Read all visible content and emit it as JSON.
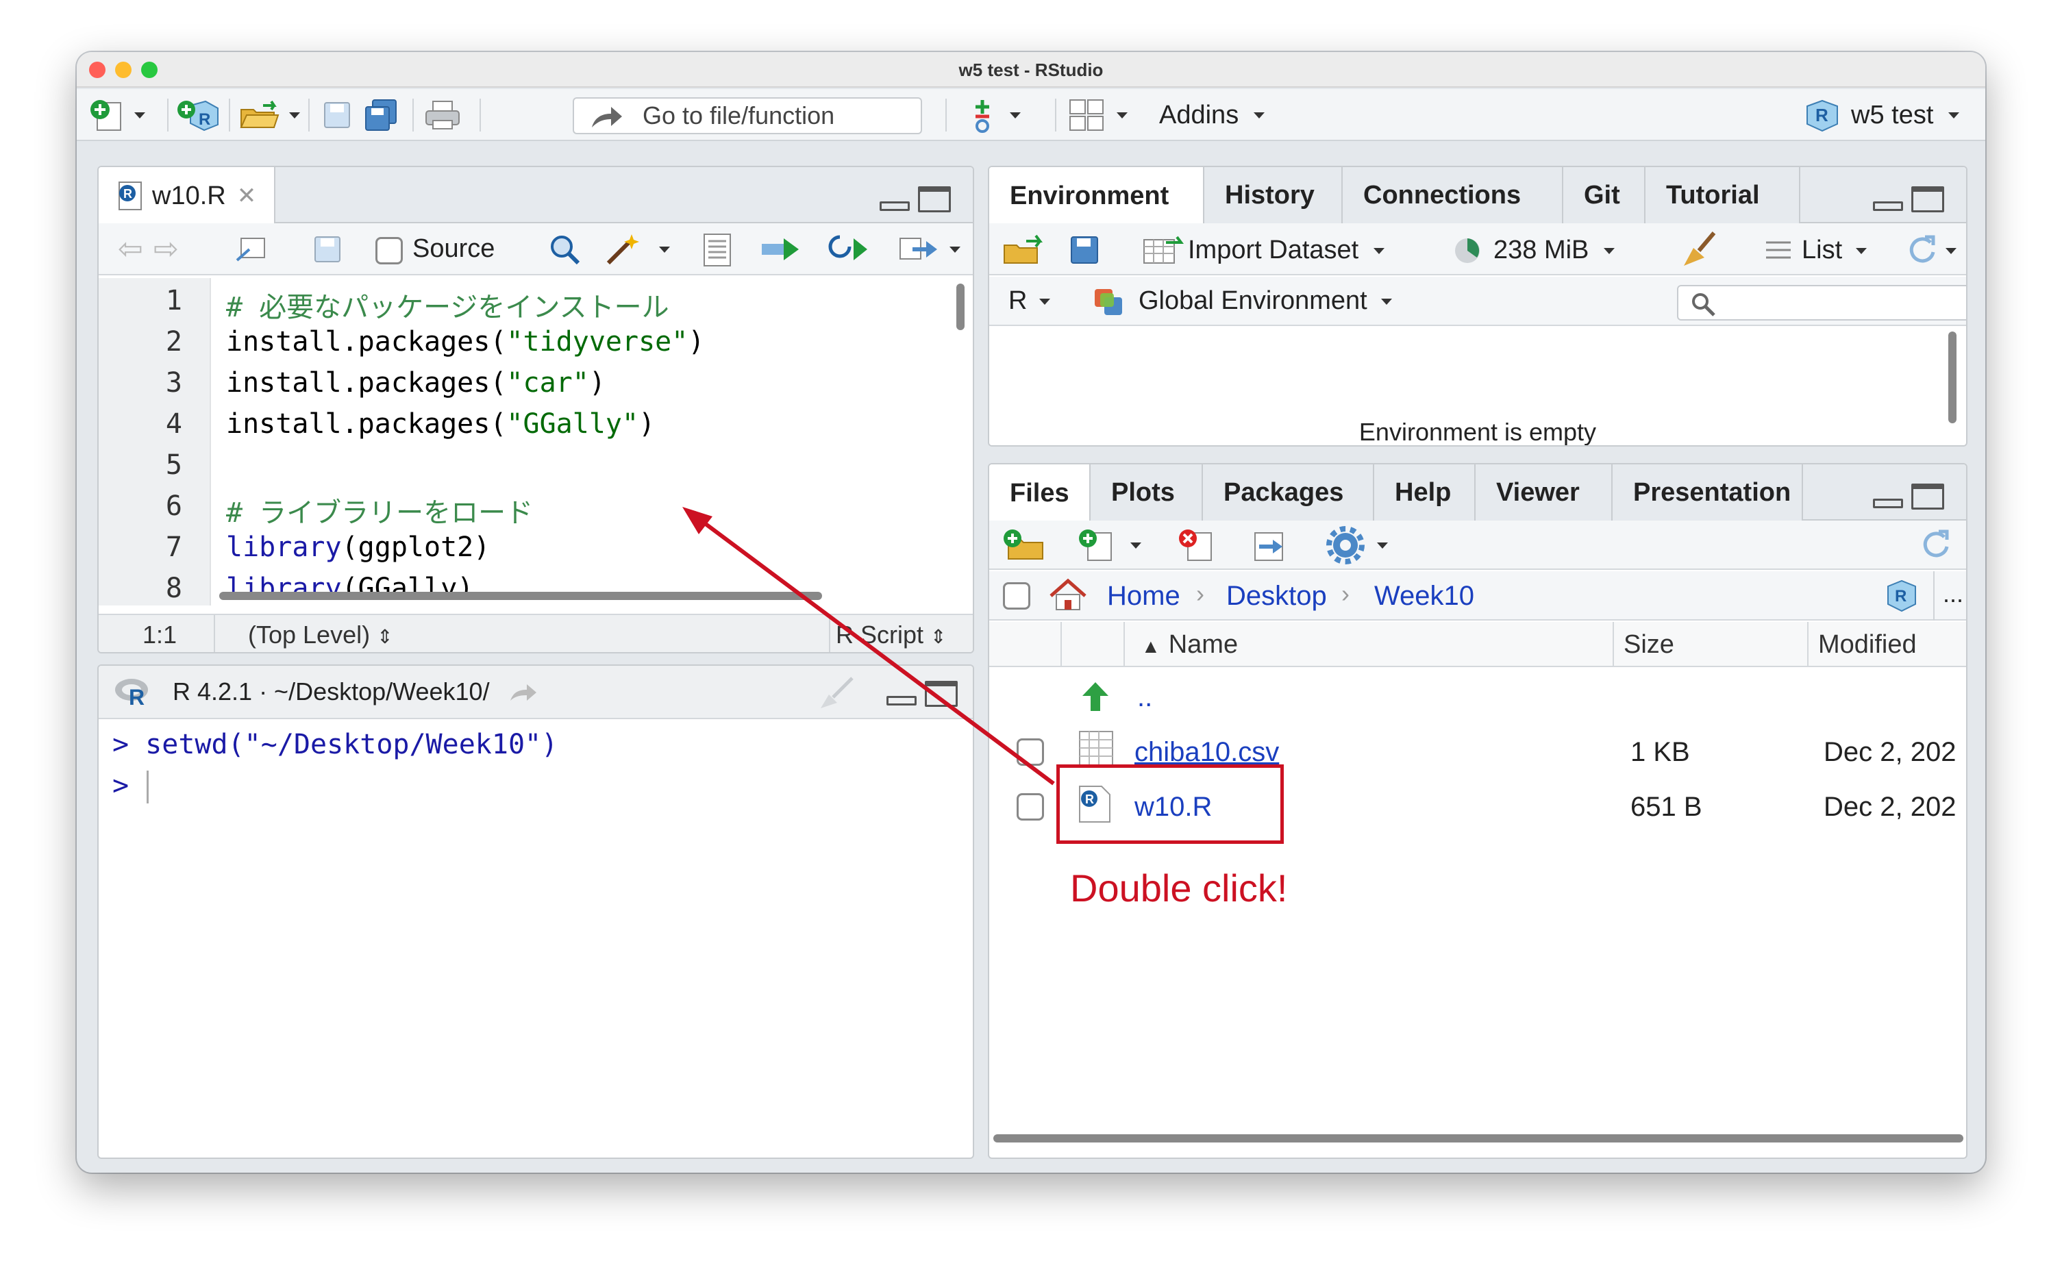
{
  "window": {
    "title": "w5 test - RStudio"
  },
  "toolbar": {
    "goto_placeholder": "Go to file/function",
    "addins_label": "Addins",
    "project_label": "w5 test"
  },
  "source_pane": {
    "tab_label": "w10.R",
    "source_label": "Source",
    "lines": [
      {
        "no": "1",
        "text": "# 必要なパッケージをインストール"
      },
      {
        "no": "2",
        "fn": "install.packages(",
        "str": "\"tidyverse\"",
        "end": ")"
      },
      {
        "no": "3",
        "fn": "install.packages(",
        "str": "\"car\"",
        "end": ")"
      },
      {
        "no": "4",
        "fn": "install.packages(",
        "str": "\"GGally\"",
        "end": ")"
      },
      {
        "no": "5",
        "text": ""
      },
      {
        "no": "6",
        "text": "# ライブラリーをロード"
      },
      {
        "no": "7",
        "kw": "library",
        "rest": "(ggplot2)"
      },
      {
        "no": "8",
        "kw": "library",
        "rest": "(GGally)"
      }
    ],
    "status_position": "1:1",
    "status_scope": "(Top Level)",
    "status_type": "R Script"
  },
  "console_pane": {
    "header": "R 4.2.1 · ~/Desktop/Week10/",
    "line1": "> setwd(\"~/Desktop/Week10\")",
    "prompt": ">"
  },
  "env_pane": {
    "tabs": [
      "Environment",
      "History",
      "Connections",
      "Git",
      "Tutorial"
    ],
    "import_label": "Import Dataset",
    "memory_label": "238 MiB",
    "view_label": "List",
    "lang_label": "R",
    "scope_label": "Global Environment",
    "empty_text": "Environment is empty"
  },
  "files_pane": {
    "tabs": [
      "Files",
      "Plots",
      "Packages",
      "Help",
      "Viewer",
      "Presentation"
    ],
    "breadcrumb": [
      "Home",
      "Desktop",
      "Week10"
    ],
    "more_label": "...",
    "columns": {
      "name": "Name",
      "size": "Size",
      "modified": "Modified"
    },
    "parent_label": "..",
    "rows": [
      {
        "name": "chiba10.csv",
        "size": "1 KB",
        "modified": "Dec 2, 202"
      },
      {
        "name": "w10.R",
        "size": "651 B",
        "modified": "Dec 2, 202"
      }
    ]
  },
  "annotation": {
    "callout": "Double click!",
    "color": "#cc1122"
  },
  "colors": {
    "accent_blue": "#1a3fbf",
    "comment_green": "#3b8a4c",
    "keyword_blue": "#1a1aa6"
  }
}
